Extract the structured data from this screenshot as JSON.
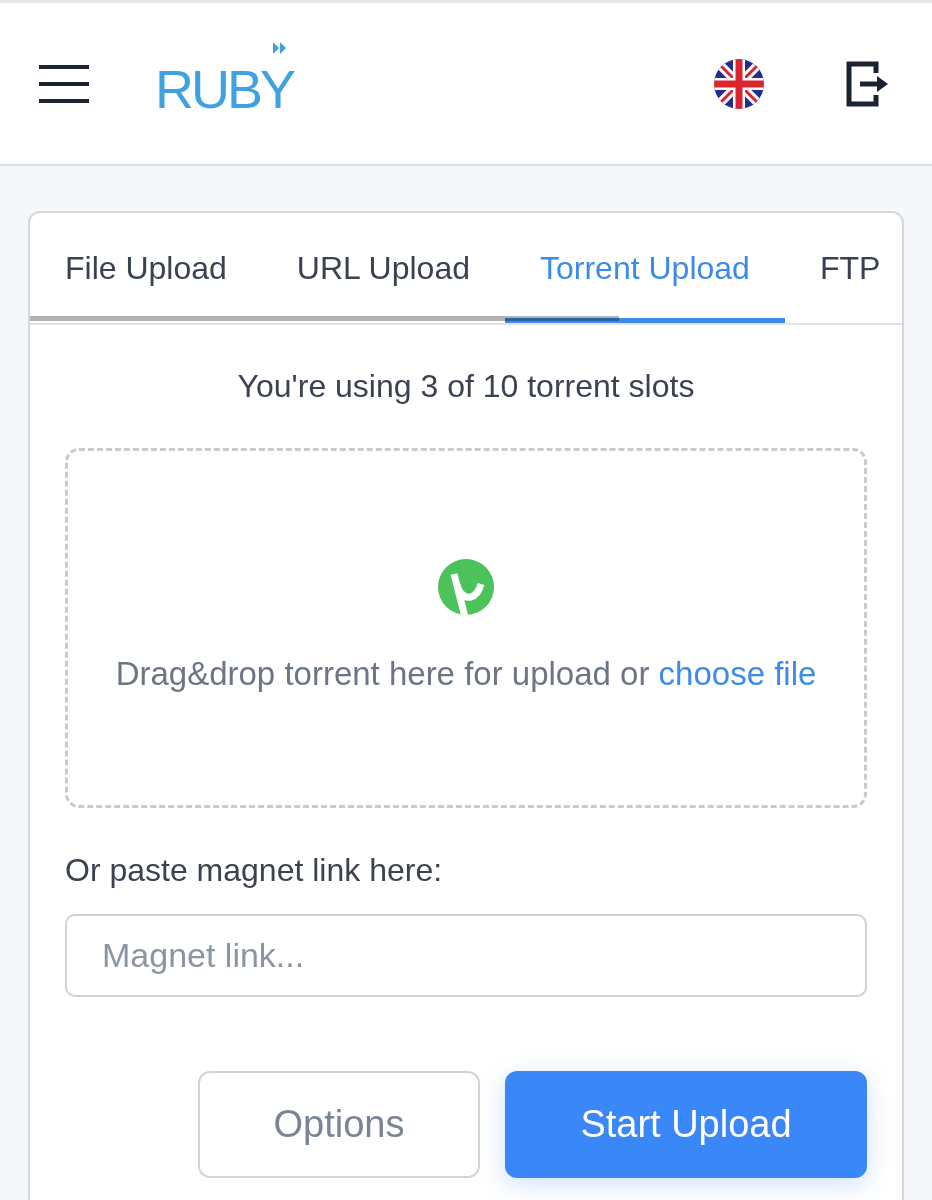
{
  "header": {
    "logo": "RUBY"
  },
  "tabs": [
    {
      "label": "File Upload",
      "selected": false
    },
    {
      "label": "URL Upload",
      "selected": false
    },
    {
      "label": "Torrent Upload",
      "selected": true
    },
    {
      "label": "FTP",
      "selected": false
    }
  ],
  "slots_notice": "You're using 3 of 10 torrent slots",
  "dropzone": {
    "text": "Drag&drop torrent here for upload or",
    "link": "choose file"
  },
  "magnet": {
    "label": "Or paste magnet link here:",
    "placeholder": "Magnet link..."
  },
  "buttons": [
    {
      "label": "Options",
      "kind": "secondary"
    },
    {
      "label": "Start Upload",
      "kind": "primary"
    }
  ]
}
